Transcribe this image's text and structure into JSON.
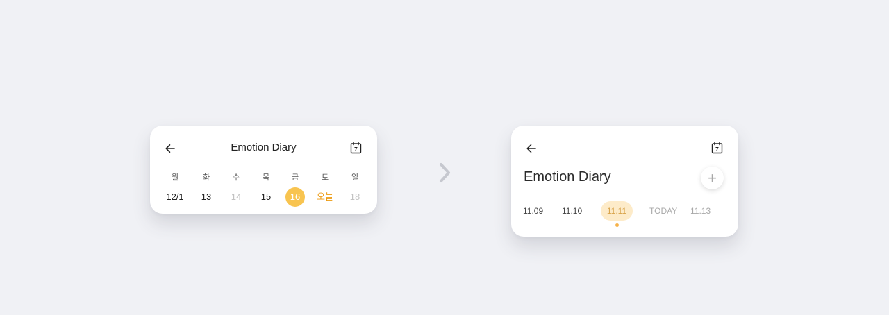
{
  "left_card": {
    "title": "Emotion Diary",
    "calendar_icon_day": "7",
    "days": [
      {
        "weekday": "월",
        "date": "12/1",
        "state": "normal"
      },
      {
        "weekday": "화",
        "date": "13",
        "state": "normal"
      },
      {
        "weekday": "수",
        "date": "14",
        "state": "muted"
      },
      {
        "weekday": "목",
        "date": "15",
        "state": "normal"
      },
      {
        "weekday": "금",
        "date": "16",
        "state": "selected"
      },
      {
        "weekday": "토",
        "date": "오늘",
        "state": "today"
      },
      {
        "weekday": "일",
        "date": "18",
        "state": "muted"
      }
    ]
  },
  "right_card": {
    "title": "Emotion Diary",
    "calendar_icon_day": "7",
    "add_label": "+",
    "dates": [
      {
        "label": "11.09",
        "state": "normal"
      },
      {
        "label": "11.10",
        "state": "normal"
      },
      {
        "label": "11.11",
        "state": "selected"
      },
      {
        "label": "TODAY",
        "state": "dim"
      },
      {
        "label": "11.13",
        "state": "dim"
      }
    ]
  },
  "colors": {
    "accent": "#f8c450",
    "today_text": "#ec9a12",
    "pill_bg": "#fdebc9",
    "pill_text": "#d8a34a",
    "background": "#f0f1f5"
  },
  "icons": {
    "back": "arrow-left-icon",
    "calendar": "calendar-icon",
    "next": "chevron-right-icon",
    "add": "plus-icon"
  }
}
